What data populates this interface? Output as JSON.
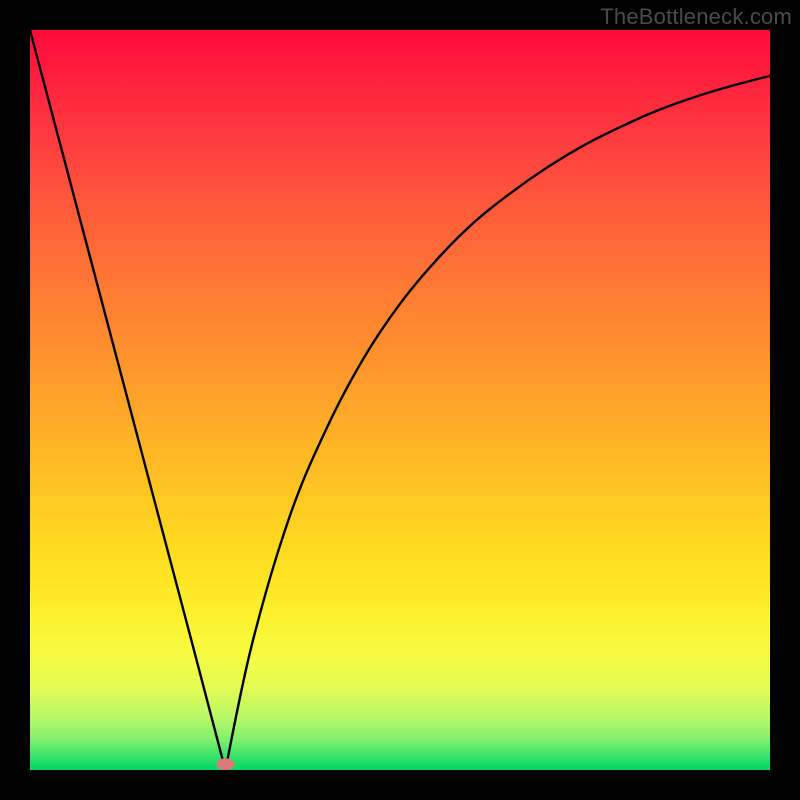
{
  "watermark": "TheBottleneck.com",
  "chart_data": {
    "type": "line",
    "title": "",
    "xlabel": "",
    "ylabel": "",
    "xlim": [
      0,
      1
    ],
    "ylim": [
      0,
      1
    ],
    "grid": false,
    "legend": false,
    "background_gradient": {
      "stops": [
        {
          "pos": 0.0,
          "color": "#ff0a3a"
        },
        {
          "pos": 0.5,
          "color": "#ffb126"
        },
        {
          "pos": 0.8,
          "color": "#fdef2a"
        },
        {
          "pos": 1.0,
          "color": "#00d765"
        }
      ],
      "direction": "top-to-bottom"
    },
    "series": [
      {
        "name": "left-branch",
        "x": [
          0.0,
          0.055,
          0.11,
          0.165,
          0.22,
          0.264
        ],
        "y": [
          1.0,
          0.792,
          0.584,
          0.376,
          0.168,
          0.0
        ]
      },
      {
        "name": "right-branch",
        "x": [
          0.264,
          0.3,
          0.35,
          0.4,
          0.45,
          0.5,
          0.55,
          0.6,
          0.65,
          0.7,
          0.75,
          0.8,
          0.85,
          0.9,
          0.95,
          1.0
        ],
        "y": [
          0.0,
          0.17,
          0.34,
          0.46,
          0.555,
          0.63,
          0.69,
          0.74,
          0.78,
          0.815,
          0.845,
          0.87,
          0.892,
          0.91,
          0.925,
          0.938
        ]
      }
    ],
    "marker": {
      "x": 0.264,
      "y": 0.008,
      "shape": "ellipse",
      "color": "#d87a7a"
    }
  }
}
